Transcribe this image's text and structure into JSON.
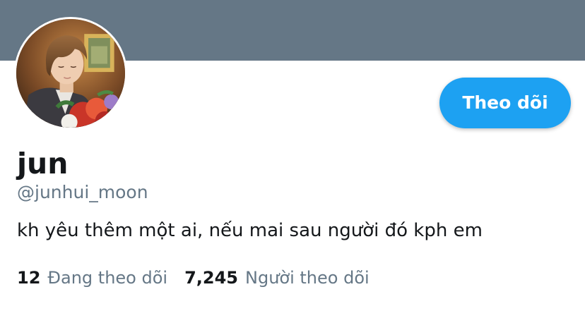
{
  "profile": {
    "display_name": "jun",
    "handle": "@junhui_moon",
    "bio": "kh yêu thêm một ai, nếu mai sau người đó kph em",
    "avatar": "avatar-photo"
  },
  "actions": {
    "follow_label": "Theo dõi"
  },
  "stats": {
    "following_count": "12",
    "following_label": "Đang theo dõi",
    "followers_count": "7,245",
    "followers_label": "Người theo dõi"
  },
  "colors": {
    "banner": "#657786",
    "accent": "#1da1f2",
    "text_primary": "#14171a",
    "text_secondary": "#657786"
  }
}
